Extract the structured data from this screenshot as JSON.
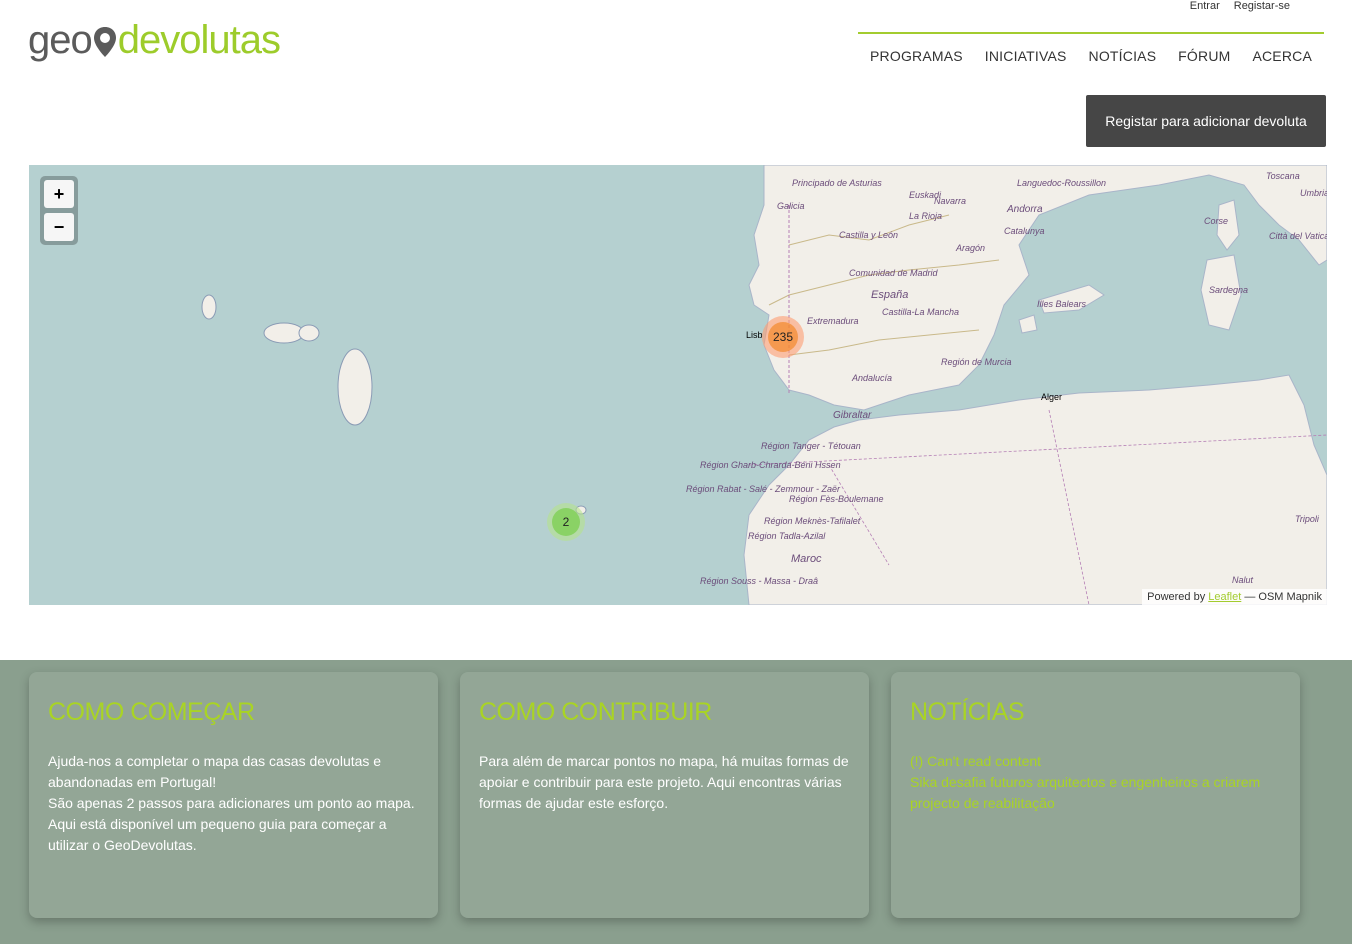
{
  "top_links": {
    "login": "Entrar",
    "register": "Registar-se"
  },
  "logo": {
    "geo": "geo",
    "devolutas": "devolutas"
  },
  "nav": {
    "items": [
      "PROGRAMAS",
      "INICIATIVAS",
      "NOTÍCIAS",
      "FÓRUM",
      "ACERCA"
    ]
  },
  "register_button": "Registar para adicionar devoluta",
  "map": {
    "zoom_in": "+",
    "zoom_out": "−",
    "clusters": [
      {
        "count": "235",
        "color": "orange"
      },
      {
        "count": "2",
        "color": "green"
      }
    ],
    "labels": {
      "asturias": "Principado de Asturias",
      "galicia": "Galicia",
      "navarra": "Navarra",
      "euskadi": "Euskadi",
      "larioja": "La Rioja",
      "castilla_leon": "Castilla y León",
      "aragon": "Aragón",
      "madrid": "Comunidad de Madrid",
      "espana": "España",
      "extremadura": "Extremadura",
      "castilla_mancha": "Castilla-La Mancha",
      "murcia": "Región de Murcia",
      "andalucia": "Andalucía",
      "gibraltar": "Gibraltar",
      "andorra": "Andorra",
      "catalunya": "Catalunya",
      "languedoc": "Languedoc-Roussillon",
      "baleares": "Illes Balears",
      "corse": "Corse",
      "sardegna": "Sardegna",
      "toscana": "Toscana",
      "umbria": "Umbria",
      "vaticano": "Città del Vaticano",
      "lisboa": "Lisb",
      "alger": "Alger",
      "tanger": "Région Tanger - Tétouan",
      "gharb": "Région Gharb-Chrarda-Béni Hssen",
      "rabat": "Région Rabat - Salé - Zemmour - Zaër",
      "fes": "Région Fès-Boulemane",
      "meknes": "Région Meknès-Tafilalet",
      "tadla": "Région Tadla-Azilal",
      "maroc": "Maroc",
      "souss": "Région Souss - Massa - Draâ",
      "tripoli": "Tripoli",
      "nalut": "Nalut"
    },
    "attribution_prefix": "Powered by",
    "attribution_leaflet": "Leaflet",
    "attribution_suffix": "— OSM Mapnik"
  },
  "cards": {
    "start": {
      "title": "COMO COMEÇAR",
      "lines": [
        "Ajuda-nos a completar o mapa das casas devolutas e abandonadas em Portugal!",
        "São apenas 2 passos para adicionares um ponto ao mapa.",
        "Aqui está disponível um pequeno guia para começar a utilizar o GeoDevolutas."
      ]
    },
    "contribute": {
      "title": "COMO CONTRIBUIR",
      "text": "Para além de marcar pontos no mapa, há muitas formas de apoiar e contribuir para este projeto. Aqui encontras várias formas de ajudar este esforço."
    },
    "news": {
      "title": "NOTÍCIAS",
      "items": [
        "(!) Can't read content",
        "Sika desafia futuros arquitectos e engenheiros a criarem projecto de reabilitação"
      ]
    }
  }
}
